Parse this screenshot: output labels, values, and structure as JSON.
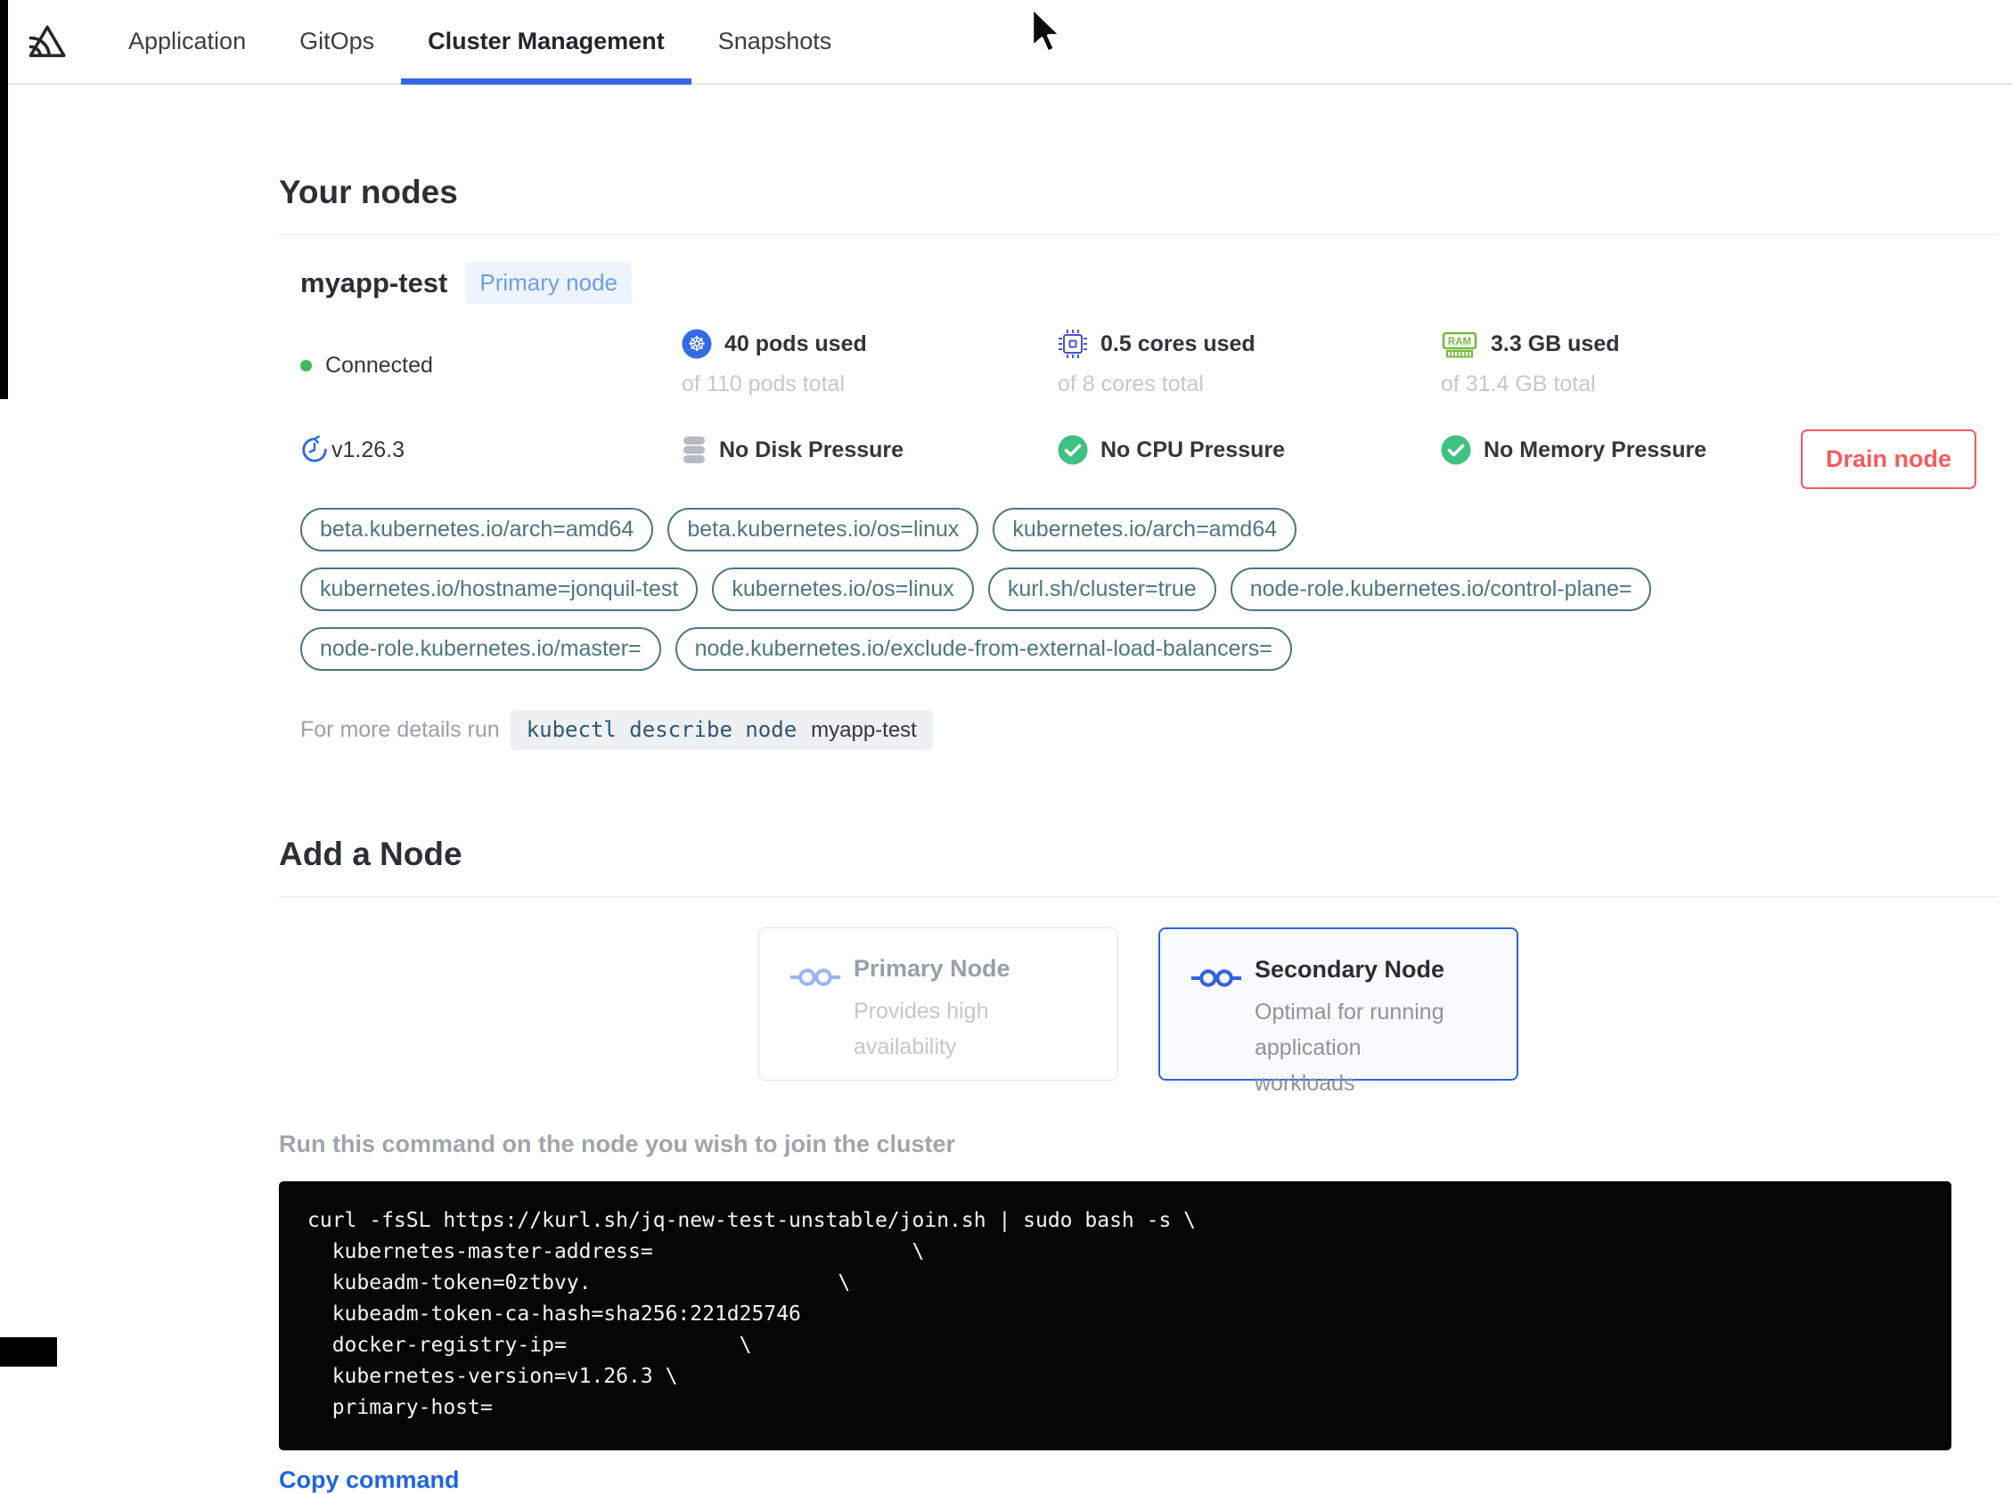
{
  "nav": {
    "logo": "replicated-logo",
    "tabs": [
      {
        "label": "Application",
        "active": false
      },
      {
        "label": "GitOps",
        "active": false
      },
      {
        "label": "Cluster Management",
        "active": true
      },
      {
        "label": "Snapshots",
        "active": false
      }
    ]
  },
  "your_nodes": {
    "title": "Your nodes",
    "node": {
      "name": "myapp-test",
      "badge": "Primary node",
      "status": "Connected",
      "version": "v1.26.3",
      "stats": [
        {
          "icon": "kubernetes-icon",
          "used": "40 pods used",
          "total": "of 110 pods total"
        },
        {
          "icon": "cpu-icon",
          "used": "0.5 cores used",
          "total": "of 8 cores total"
        },
        {
          "icon": "ram-icon",
          "used": "3.3 GB used",
          "total": "of 31.4 GB total"
        }
      ],
      "conditions": [
        {
          "icon": "disk-icon",
          "label": "No Disk Pressure"
        },
        {
          "icon": "check-circle-icon",
          "label": "No CPU Pressure"
        },
        {
          "icon": "check-circle-icon",
          "label": "No Memory Pressure"
        }
      ],
      "labels": [
        "beta.kubernetes.io/arch=amd64",
        "beta.kubernetes.io/os=linux",
        "kubernetes.io/arch=amd64",
        "kubernetes.io/hostname=jonquil-test",
        "kubernetes.io/os=linux",
        "kurl.sh/cluster=true",
        "node-role.kubernetes.io/control-plane=",
        "node-role.kubernetes.io/master=",
        "node.kubernetes.io/exclude-from-external-load-balancers="
      ],
      "details_prefix": "For more details run",
      "details_command": "kubectl describe node",
      "details_node_name": "myapp-test",
      "drain_button_label": "Drain node"
    }
  },
  "add_node": {
    "title": "Add a Node",
    "options": [
      {
        "title": "Primary Node",
        "description": "Provides high availability",
        "selected": false
      },
      {
        "title": "Secondary Node",
        "description": "Optimal for running application workloads",
        "selected": true
      }
    ],
    "instruction": "Run this command on the node you wish to join the cluster",
    "command_lines": [
      "curl -fsSL https://kurl.sh/jq-new-test-unstable/join.sh | sudo bash -s \\",
      "  kubernetes-master-address=                     \\",
      "  kubeadm-token=0ztbvy.                    \\",
      "  kubeadm-token-ca-hash=sha256:221d25746",
      "  docker-registry-ip=              \\",
      "  kubernetes-version=v1.26.3 \\",
      "  primary-host="
    ],
    "copy_label": "Copy command"
  },
  "colors": {
    "accent_blue": "#3568e4",
    "badge_blue": "#6d9fe3",
    "label_teal": "#4d767f",
    "danger_red": "#f55b5b",
    "success_green": "#3fc183",
    "kubernetes_blue": "#326ce5",
    "cpu_indigo": "#4a50d3",
    "ram_green": "#76bb3f",
    "link_blue": "#2064e4"
  }
}
